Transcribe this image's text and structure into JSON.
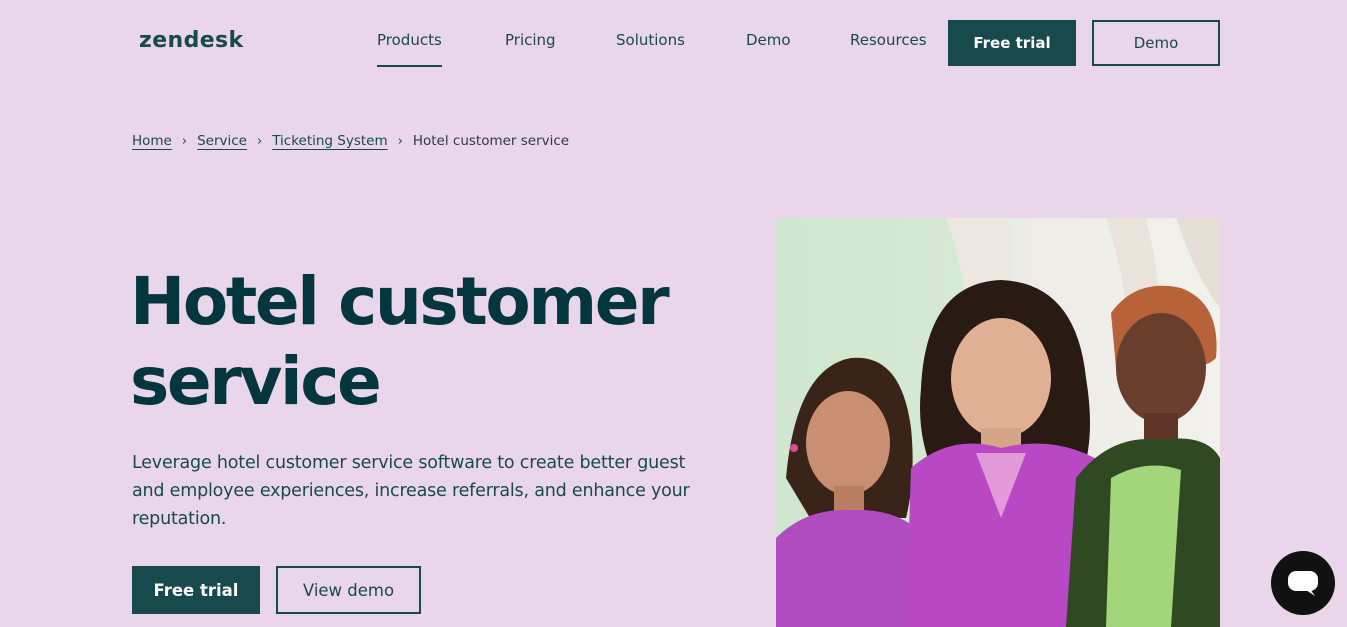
{
  "header": {
    "logo": "zendesk",
    "nav": [
      "Products",
      "Pricing",
      "Solutions",
      "Demo",
      "Resources"
    ],
    "free_trial": "Free trial",
    "demo": "Demo"
  },
  "breadcrumb": {
    "items": [
      "Home",
      "Service",
      "Ticketing System"
    ],
    "current": "Hotel customer service"
  },
  "hero": {
    "title": "Hotel customer service",
    "subtitle": "Leverage hotel customer service software to create better guest and employee experiences, increase referrals, and enhance your reputation.",
    "primary_cta": "Free trial",
    "secondary_cta": "View demo"
  },
  "colors": {
    "background": "#ead6ea",
    "brand_dark": "#17494d",
    "chat_button": "#111111"
  },
  "icons": {
    "chevron": "chevron-right-icon",
    "chat": "chat-bubble-icon"
  }
}
